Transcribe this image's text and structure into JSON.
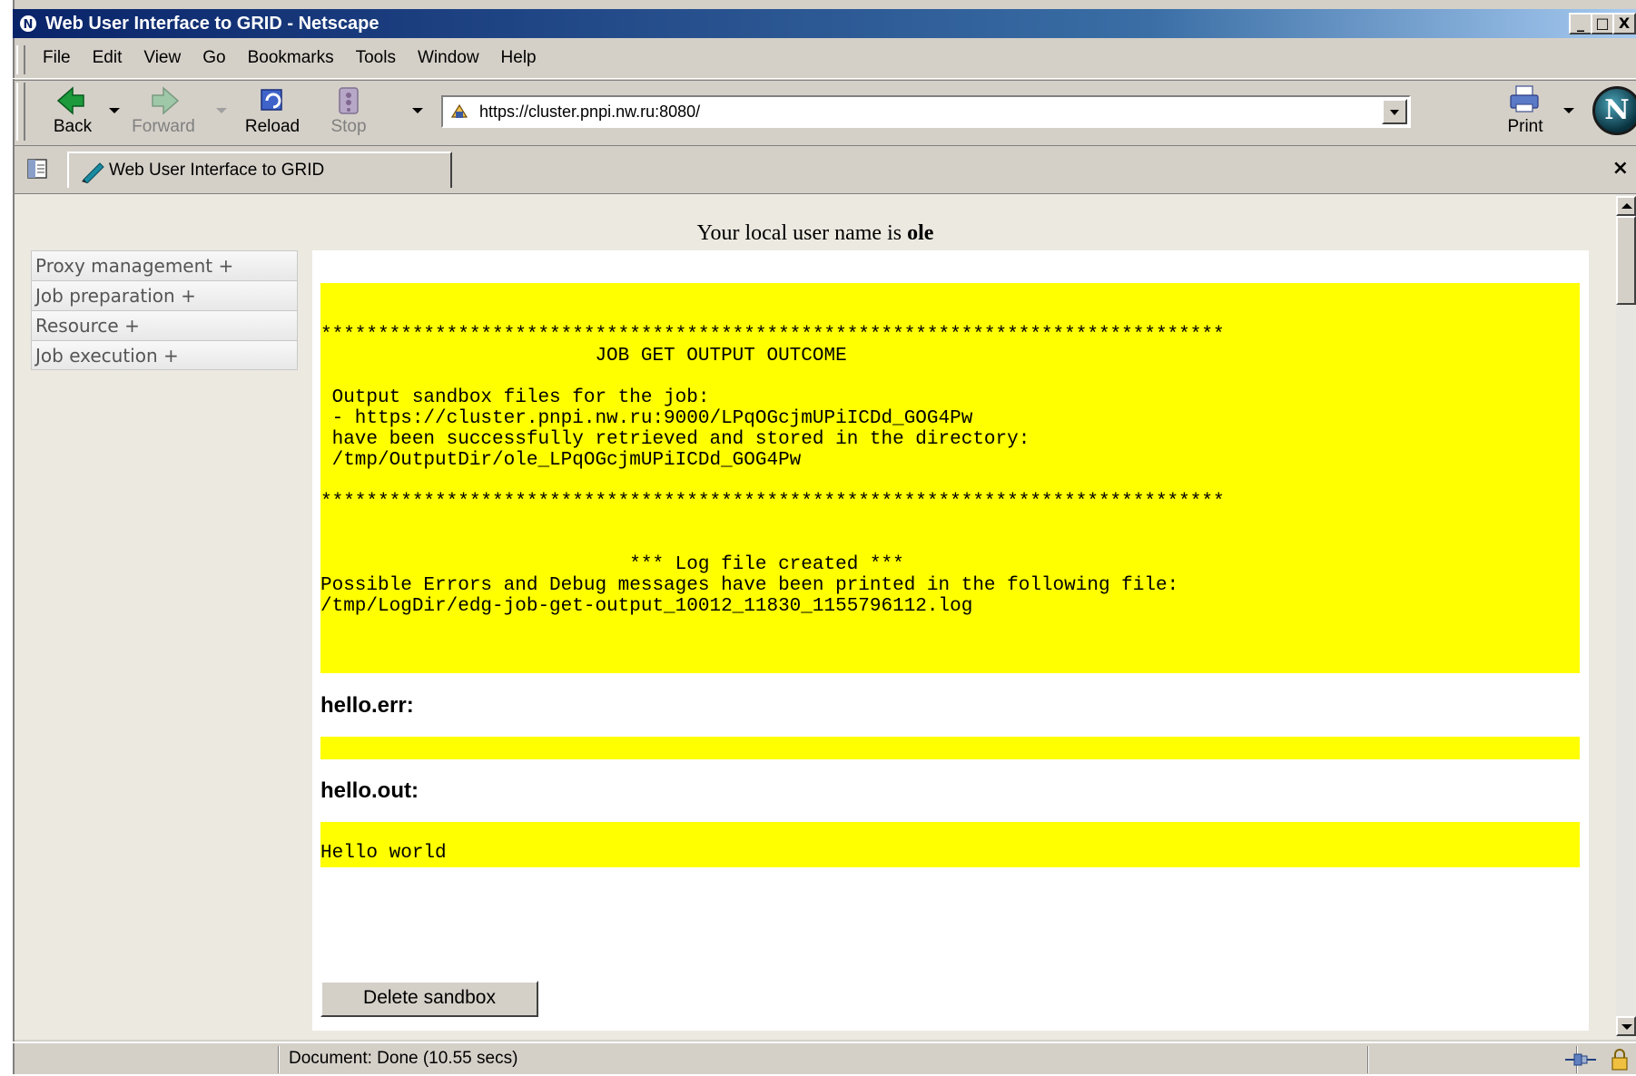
{
  "window": {
    "title": "Web User Interface to GRID - Netscape",
    "app_icon_letter": "N",
    "controls": {
      "minimize": "_",
      "maximize": "□",
      "close": "X"
    }
  },
  "menu": [
    "File",
    "Edit",
    "View",
    "Go",
    "Bookmarks",
    "Tools",
    "Window",
    "Help"
  ],
  "toolbar": {
    "back": "Back",
    "forward": "Forward",
    "reload": "Reload",
    "stop": "Stop",
    "print": "Print",
    "logo_letter": "N",
    "url": "https://cluster.pnpi.nw.ru:8080/"
  },
  "tabs": {
    "active_tab": "Web User Interface to GRID",
    "close": "×"
  },
  "page": {
    "user_prefix": "Your local user name is ",
    "user_name": "ole",
    "sidebar": [
      "Proxy management +",
      "Job preparation +",
      "Resource +",
      "Job execution +"
    ],
    "outcome_text": "\n\n*******************************************************************************\n                        JOB GET OUTPUT OUTCOME\n\n Output sandbox files for the job:\n - https://cluster.pnpi.nw.ru:9000/LPqOGcjmUPiICDd_GOG4Pw\n have been successfully retrieved and stored in the directory:\n /tmp/OutputDir/ole_LPqOGcjmUPiICDd_GOG4Pw\n\n*******************************************************************************\n\n\n                           *** Log file created ***\nPossible Errors and Debug messages have been printed in the following file:\n/tmp/LogDir/edg-job-get-output_10012_11830_1155796112.log\n",
    "err_heading": "hello.err:",
    "err_text": "",
    "out_heading": "hello.out:",
    "out_text": "\nHello world",
    "delete_button": "Delete sandbox"
  },
  "status": {
    "message": "Document: Done (10.55 secs)"
  },
  "colors": {
    "output_background": "#ffff00",
    "title_bar": "#0a246a",
    "chrome": "#d4d0c8"
  }
}
